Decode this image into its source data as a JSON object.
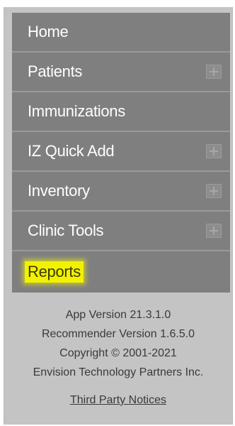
{
  "nav": {
    "items": [
      {
        "label": "Home",
        "expandable": false,
        "highlighted": false
      },
      {
        "label": "Patients",
        "expandable": true,
        "highlighted": false
      },
      {
        "label": "Immunizations",
        "expandable": false,
        "highlighted": false
      },
      {
        "label": "IZ Quick Add",
        "expandable": true,
        "highlighted": false
      },
      {
        "label": "Inventory",
        "expandable": true,
        "highlighted": false
      },
      {
        "label": "Clinic Tools",
        "expandable": true,
        "highlighted": false
      },
      {
        "label": "Reports",
        "expandable": false,
        "highlighted": true
      }
    ],
    "expand_icon": "plus-icon"
  },
  "footer": {
    "app_version": "App Version 21.3.1.0",
    "recommender_version": "Recommender Version 1.6.5.0",
    "copyright": "Copyright © 2001-2021",
    "company": "Envision Technology Partners Inc.",
    "third_party_link": "Third Party Notices"
  },
  "colors": {
    "nav_background": "#7f7f7f",
    "panel_background": "#c4c4c4",
    "highlight": "#f2f200"
  }
}
